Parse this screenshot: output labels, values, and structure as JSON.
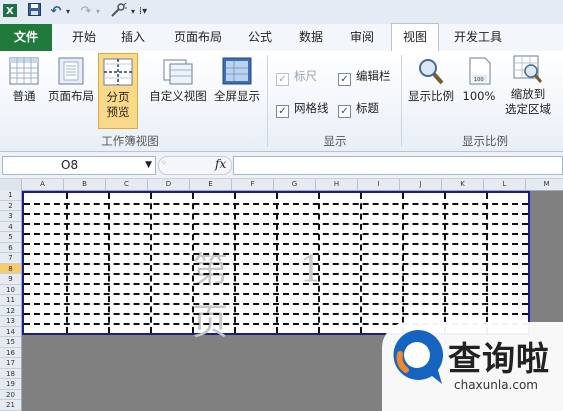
{
  "qat": {
    "undo": "↶",
    "redo": "↷"
  },
  "tabs": [
    "文件",
    "开始",
    "插入",
    "页面布局",
    "公式",
    "数据",
    "审阅",
    "视图",
    "开发工具"
  ],
  "ribbon": {
    "workbook_views": {
      "normal": "普通",
      "page_layout": "页面布局",
      "page_break_preview_l1": "分页",
      "page_break_preview_l2": "预览",
      "custom_views": "自定义视图",
      "full_screen": "全屏显示",
      "group_label": "工作簿视图"
    },
    "show": {
      "ruler": "标尺",
      "formula_bar": "编辑栏",
      "gridlines": "网格线",
      "headings": "标题",
      "group_label": "显示"
    },
    "zoom": {
      "zoom": "显示比例",
      "hundred": "100%",
      "zoom_to_selection_l1": "缩放到",
      "zoom_to_selection_l2": "选定区域",
      "group_label": "显示比例"
    }
  },
  "formula_bar": {
    "name_box": "O8",
    "fx": "fx",
    "value": ""
  },
  "sheet": {
    "columns": [
      "A",
      "B",
      "C",
      "D",
      "E",
      "F",
      "G",
      "H",
      "I",
      "J",
      "K",
      "L",
      "M"
    ],
    "rows": [
      "1",
      "2",
      "3",
      "4",
      "5",
      "6",
      "7",
      "8",
      "9",
      "10",
      "11",
      "12",
      "13",
      "14",
      "15",
      "16",
      "17",
      "18",
      "19",
      "20",
      "21"
    ],
    "selected_row": "8",
    "watermark": "第 1 页"
  },
  "logo": {
    "name": "查询啦",
    "url": "chaxunla.com"
  },
  "colors": {
    "file_tab": "#1f7a3c",
    "print_border": "#1b1b8a",
    "logo_blue": "#1565c0",
    "logo_orange": "#f0892b"
  }
}
